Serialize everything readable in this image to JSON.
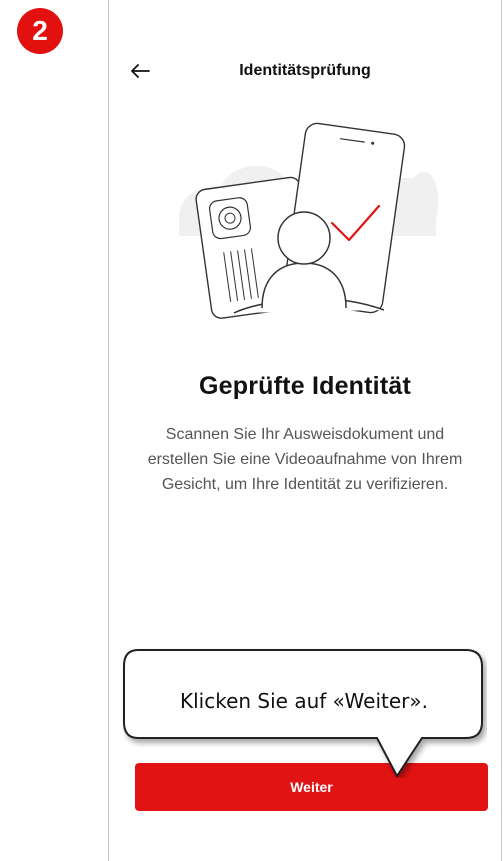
{
  "step": {
    "number": "2",
    "color": "#e0110f"
  },
  "header": {
    "title": "Identitätsprüfung",
    "back_icon": "arrow-left-icon"
  },
  "content": {
    "illustration": "verified-identity-illustration",
    "headline": "Geprüfte Identität",
    "description": "Scannen Sie Ihr Ausweisdokument und erstellen Sie eine Videoaufnahme von Ihrem Gesicht, um Ihre Identität zu verifizieren."
  },
  "actions": {
    "continue_label": "Weiter",
    "accent_color": "#e21313"
  },
  "callout": {
    "text": "Klicken Sie auf «Weiter»."
  }
}
